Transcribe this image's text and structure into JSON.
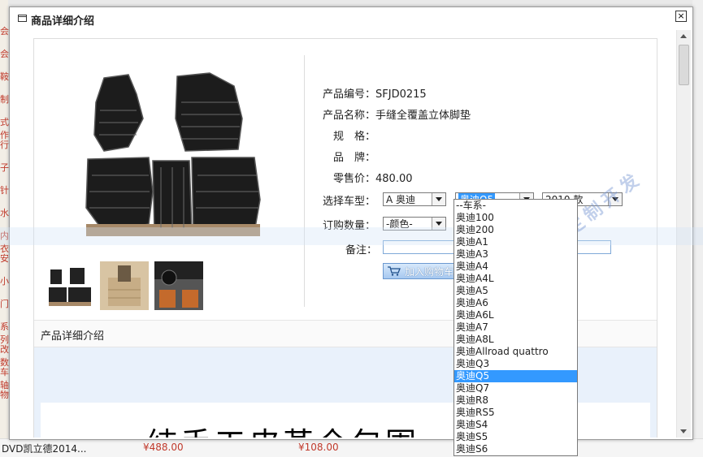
{
  "background": {
    "left_items": [
      "会",
      "会",
      "鞍",
      "制",
      "式作",
      "行",
      "子",
      "针",
      "水",
      "内衣",
      "安",
      "小",
      "门",
      "系列",
      "改数",
      "车轴",
      "物"
    ],
    "bottom_left_text": "DVD凯立德2014...",
    "bottom_prices": [
      "¥488.00",
      "¥108.00"
    ]
  },
  "dialog": {
    "title": "商品详细介绍",
    "close_icon": "×"
  },
  "product": {
    "fields": [
      {
        "label": "产品编号：",
        "value": "SFJD0215"
      },
      {
        "label": "产品名称：",
        "value": "手缝全覆盖立体脚垫"
      },
      {
        "label": "规　格：",
        "value": ""
      },
      {
        "label": "品　牌：",
        "value": ""
      },
      {
        "label": "零售价：",
        "value": "480.00"
      }
    ],
    "car_label": "选择车型：",
    "car_brand": "A 奥迪",
    "car_model": "奥迪Q5",
    "car_year": "2010 款",
    "qty_label": "订购数量：",
    "color_select": "-颜色-",
    "remark_label": "备注：",
    "remark_value": "",
    "cart_button": "加入购物车"
  },
  "detail": {
    "heading": "产品详细介绍",
    "banner_text": "纯手工皮革全包围"
  },
  "dropdown_options": [
    "--车系-",
    "奥迪100",
    "奥迪200",
    "奥迪A1",
    "奥迪A3",
    "奥迪A4",
    "奥迪A4L",
    "奥迪A5",
    "奥迪A6",
    "奥迪A6L",
    "奥迪A7",
    "奥迪A8L",
    "奥迪Allroad quattro",
    "奥迪Q3",
    "奥迪Q5",
    "奥迪Q7",
    "奥迪R8",
    "奥迪RS5",
    "奥迪S4",
    "奥迪S5",
    "奥迪S6"
  ],
  "dropdown_selected": "奥迪Q5",
  "watermark": "雨田软件定制开发",
  "colors": {
    "highlight": "#3399ff",
    "price": "#c0392b"
  }
}
